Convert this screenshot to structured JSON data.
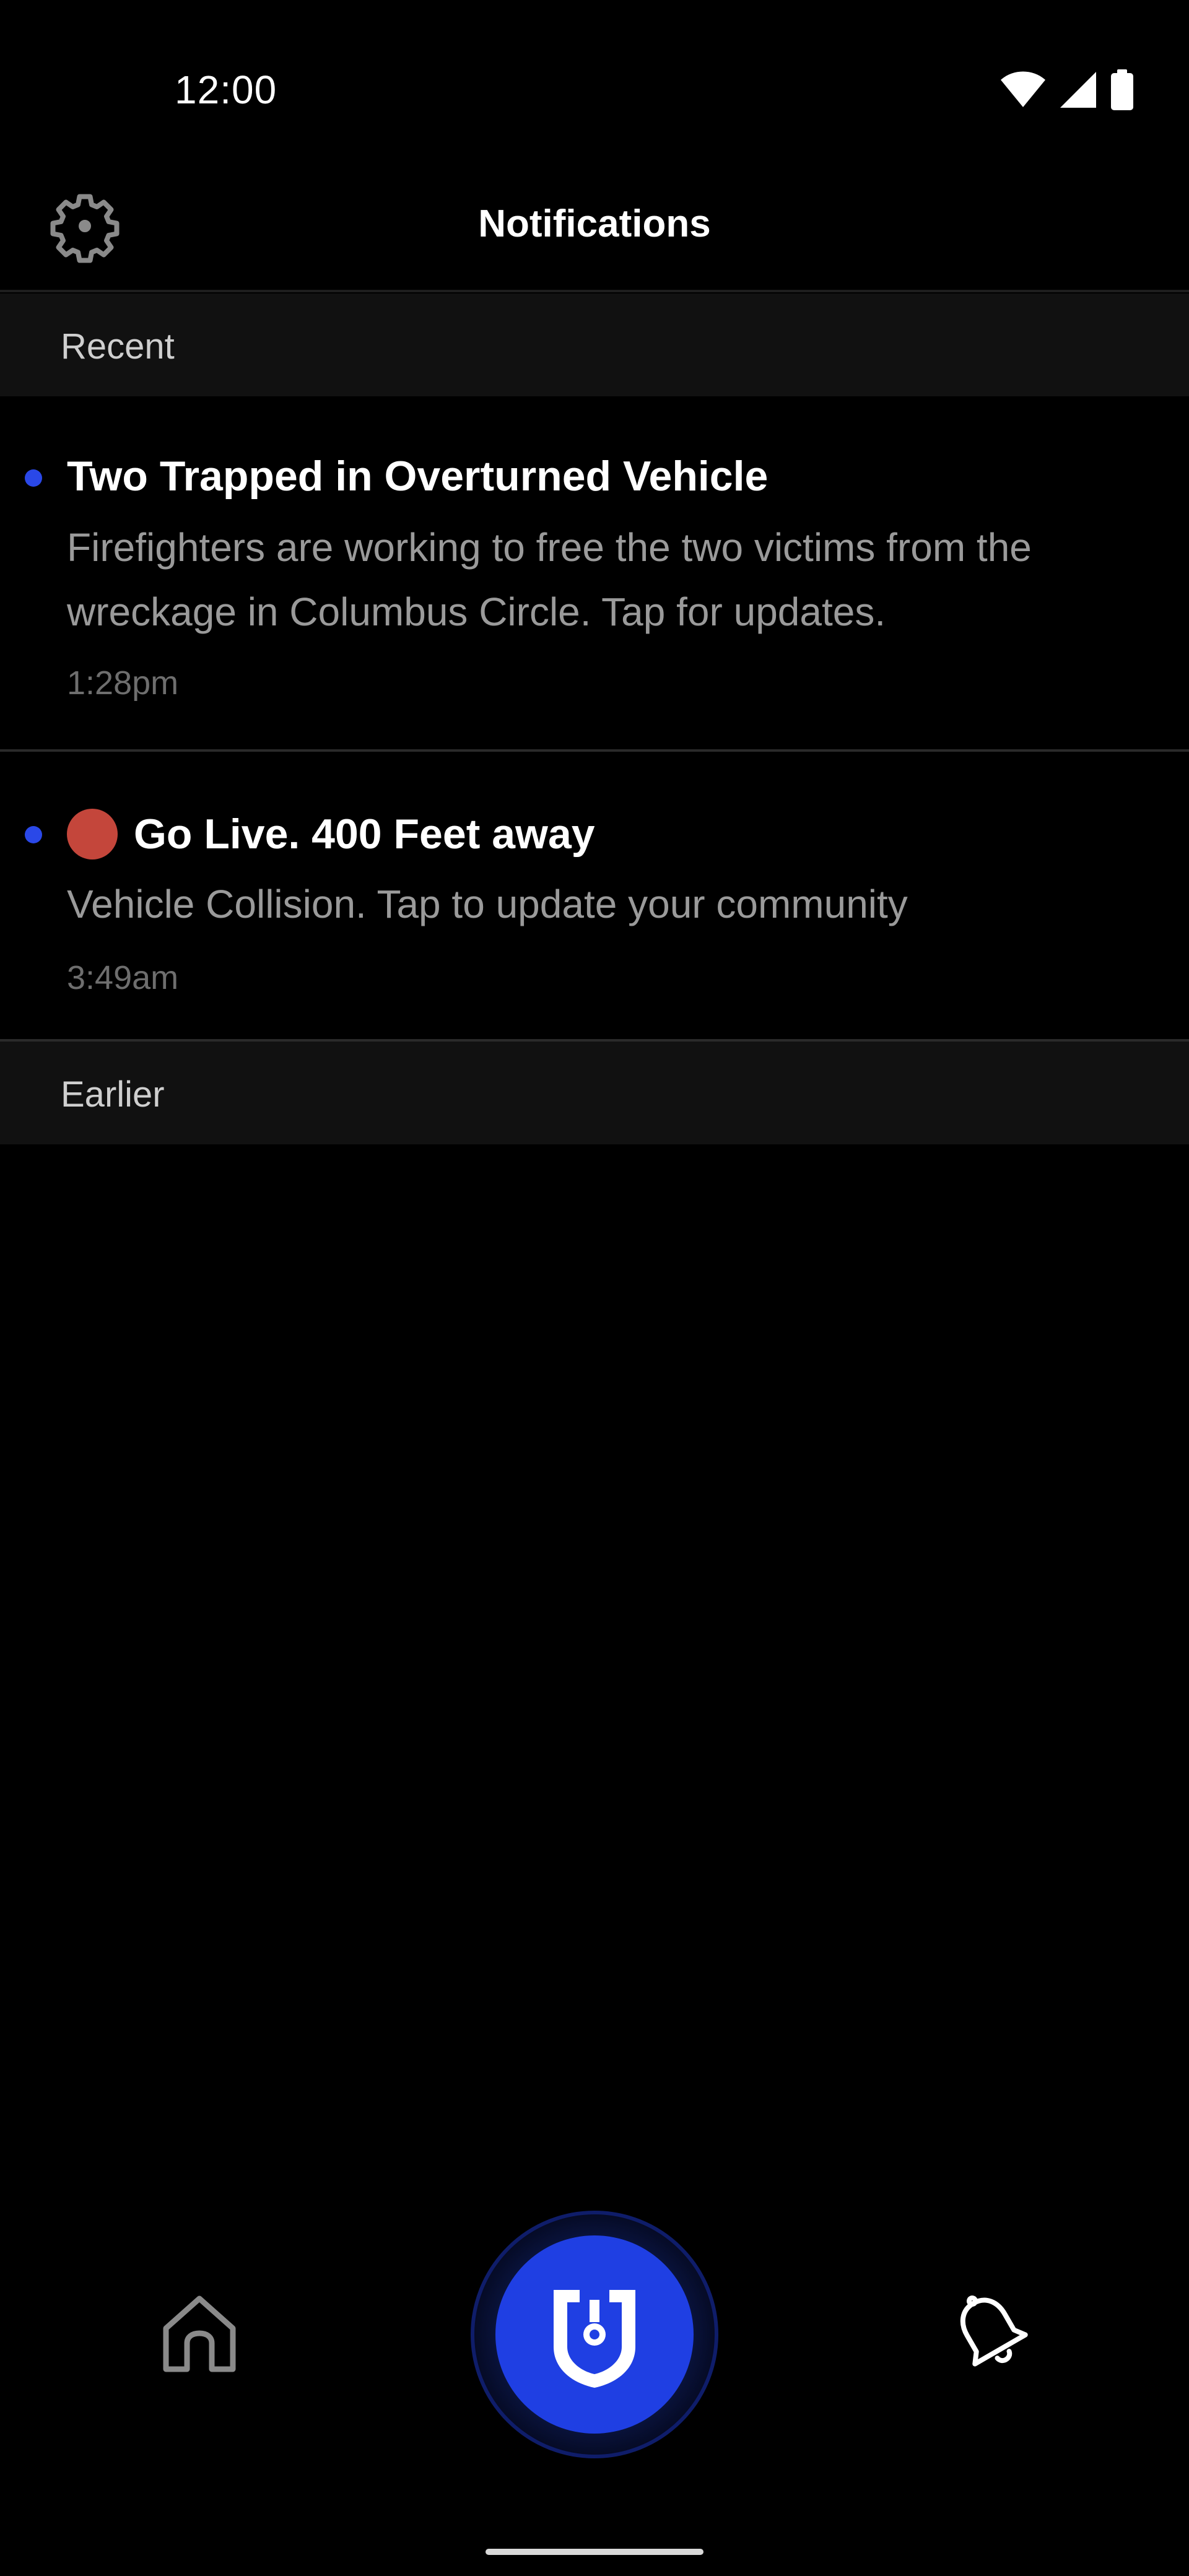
{
  "status_bar": {
    "time": "12:00",
    "icons": [
      "wifi-icon",
      "signal-icon",
      "battery-icon"
    ]
  },
  "header": {
    "title": "Notifications",
    "settings_icon": "gear-icon"
  },
  "sections": {
    "recent_label": "Recent",
    "earlier_label": "Earlier"
  },
  "notifications": [
    {
      "title": "Two Trapped in Overturned Vehicle",
      "body": "Firefighters are working to free the two victims from the wreckage in Columbus Circle. Tap for updates.",
      "time": "1:28pm",
      "unread": true
    },
    {
      "title": "Go Live. 400 Feet away",
      "body": "Vehicle Collision. Tap to update your community",
      "time": "3:49am",
      "unread": true,
      "live_indicator": true
    }
  ],
  "bottom_nav": {
    "items": [
      "home-icon",
      "shield-icon",
      "bell-icon"
    ]
  },
  "colors": {
    "background": "#000000",
    "section_bg": "#111111",
    "accent_blue": "#1f3fe3",
    "unread_dot": "#2a48e8",
    "live_red": "#c4463b",
    "body_text": "#9a9a9a",
    "time_text": "#6e6e6e"
  }
}
